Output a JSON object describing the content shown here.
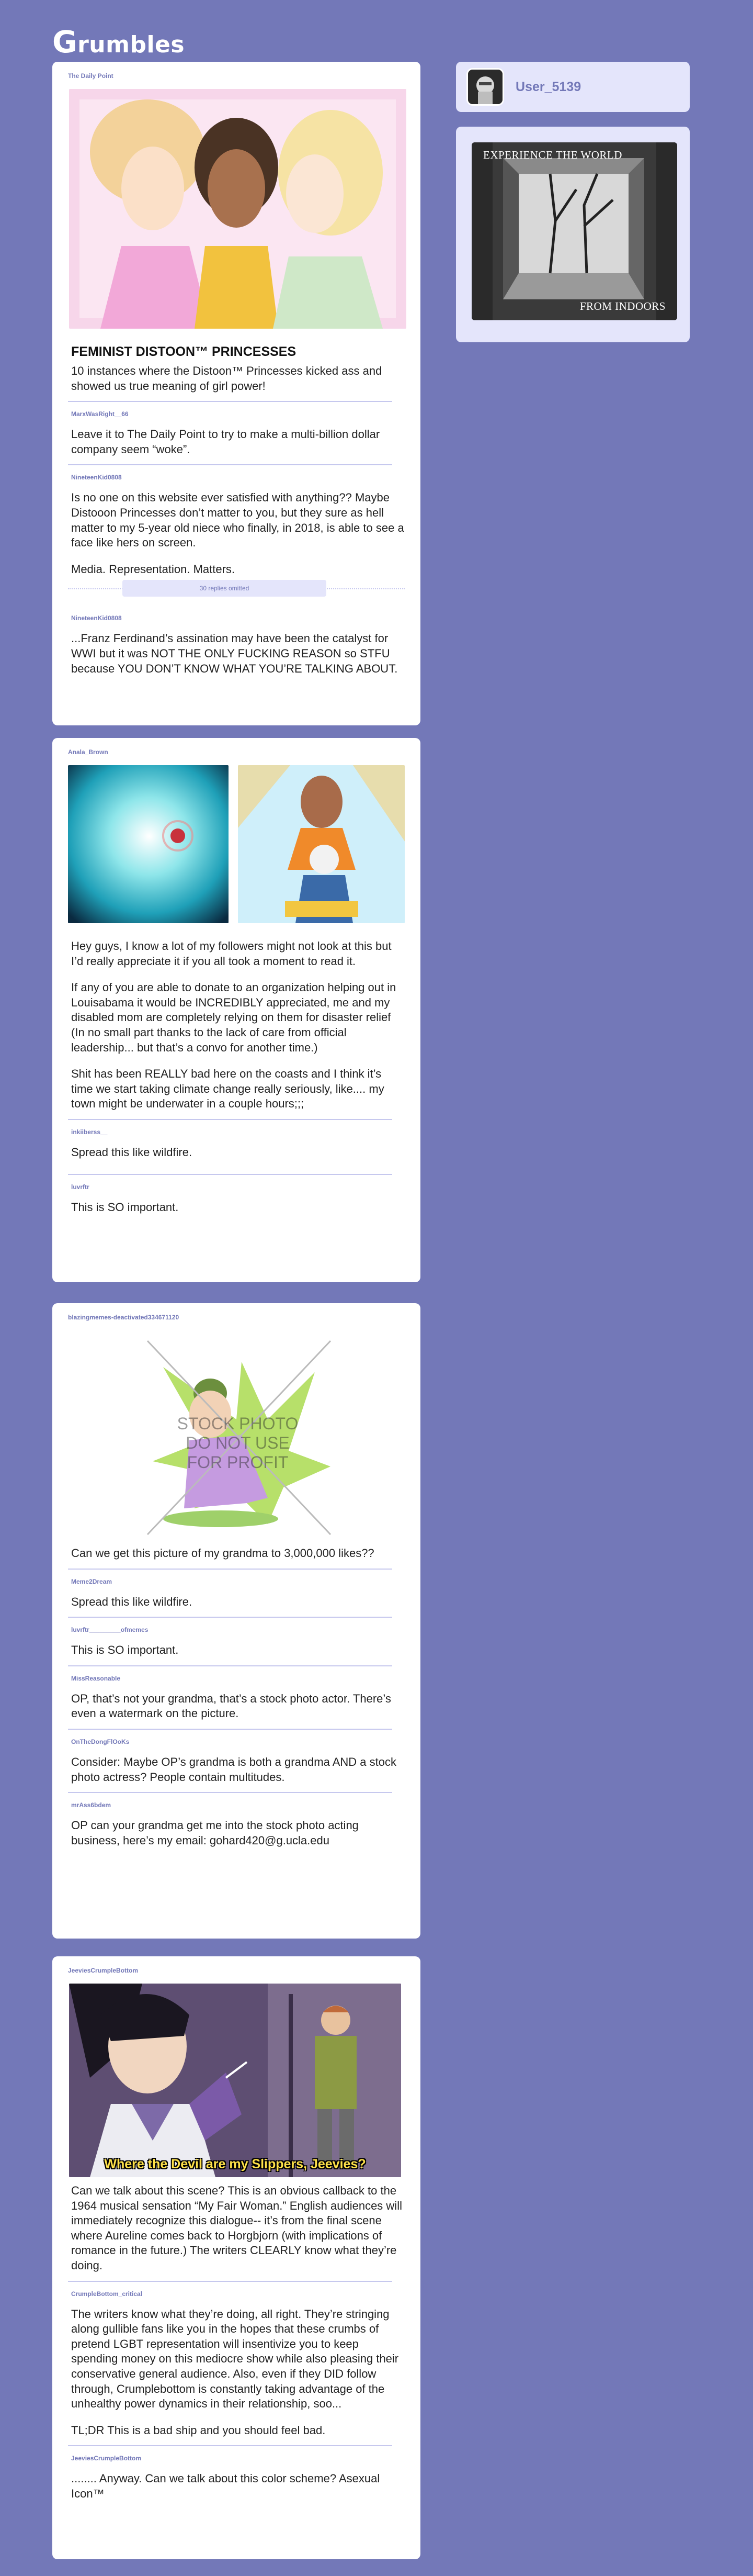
{
  "app": {
    "logo_first": "G",
    "logo_rest": "rumbles"
  },
  "sidebar": {
    "username": "User_5139",
    "ad": {
      "top_text": "EXPERIENCE THE WORLD",
      "bottom_text": "FROM INDOORS"
    }
  },
  "posts": [
    {
      "author": "The Daily Point",
      "title": "FEMINIST DISTOON™ PRINCESSES",
      "body": "10 instances where the Distoon™ Princesses kicked ass and showed us true meaning of girl power!",
      "replies": [
        {
          "author": "MarxWasRight__66",
          "body": "Leave it to The Daily Point to try to make a multi-billion dollar company seem “woke”."
        },
        {
          "author": "NineteenKid0808",
          "body_paragraphs": [
            "Is no one on this website ever satisfied with anything?? Maybe Distooon Princesses don’t matter to you, but they sure as hell matter to my 5-year old niece who finally, in 2018, is able to see a face like hers on screen.",
            "Media. Representation. Matters."
          ]
        },
        {
          "omitted": "30 replies omitted"
        },
        {
          "author": "NineteenKid0808",
          "body": "...Franz Ferdinand’s assination may have been the catalyst for WWI but it was NOT THE ONLY FUCKING REASON so STFU because YOU DON’T KNOW WHAT YOU’RE TALKING ABOUT."
        }
      ]
    },
    {
      "author": "Anala_Brown",
      "body_paragraphs": [
        "Hey guys, I know a lot of my followers might not look at this but I’d really appreciate it if you all took a moment to read it.",
        "If any of you are able to donate to an organization helping out in Louisabama it would be INCREDIBLY appreciated, me and my disabled mom are completely relying on them for disaster relief (In no small part thanks to the lack of care from official leadership... but that’s a convo for another time.)",
        "Shit has been REALLY bad here on the coasts and I think it’s time we start taking climate change really seriously, like.... my town might be underwater in a couple hours;;;"
      ],
      "replies": [
        {
          "author": "inkiiberss__",
          "body": "Spread this like wildfire."
        },
        {
          "author": "luvrftr",
          "body": "This is SO important."
        }
      ]
    },
    {
      "author": "blazingmemes-deactivated334671120",
      "watermark": [
        "STOCK PHOTO",
        "DO NOT USE",
        "FOR PROFIT"
      ],
      "body": "Can we get this picture of my grandma to 3,000,000 likes??",
      "replies": [
        {
          "author": "Meme2Dream",
          "body": "Spread this like wildfire."
        },
        {
          "author": "luvrftr_________ofmemes",
          "body": "This is SO important."
        },
        {
          "author": "MissReasonable",
          "body": "OP, that’s not your grandma, that’s a stock photo actor. There’s even a watermark on the picture."
        },
        {
          "author": "OnTheDongFlOoKs",
          "body": "Consider: Maybe OP’s grandma is both a grandma AND a stock photo actress? People contain multitudes."
        },
        {
          "author": "mrAss6bdem",
          "body": "OP can your grandma get me into the stock photo acting business, here’s my email: gohard420@g.ucla.edu"
        }
      ]
    },
    {
      "author": "JeeviesCrumpleBottom",
      "caption": "Where the Devil are my Slippers, Jeevies?",
      "body": "Can we talk about this scene? This is an obvious callback to the 1964 musical sensation “My Fair Woman.” English audiences will immediately recognize this dialogue-- it’s from the final scene where Aureline comes back to Horgbjorn (with implications of romance in the future.) The writers CLEARLY know what they’re doing.",
      "replies": [
        {
          "author": "CrumpleBottom_critical",
          "body_paragraphs": [
            "The writers know what they’re doing, all right. They’re stringing along gullible fans like you in the hopes that these crumbs of pretend LGBT representation will insentivize you to keep spending money on this mediocre show while also pleasing their conservative general audience. Also, even if they DID follow through, Crumplebottom is constantly taking advantage of the unhealthy power dynamics in their relationship, soo...",
            "TL;DR This is a bad ship and you should feel bad."
          ]
        },
        {
          "author": "JeeviesCrumpleBottom",
          "body": "........  Anyway. Can we talk about this color scheme? Asexual Icon™"
        }
      ]
    }
  ]
}
